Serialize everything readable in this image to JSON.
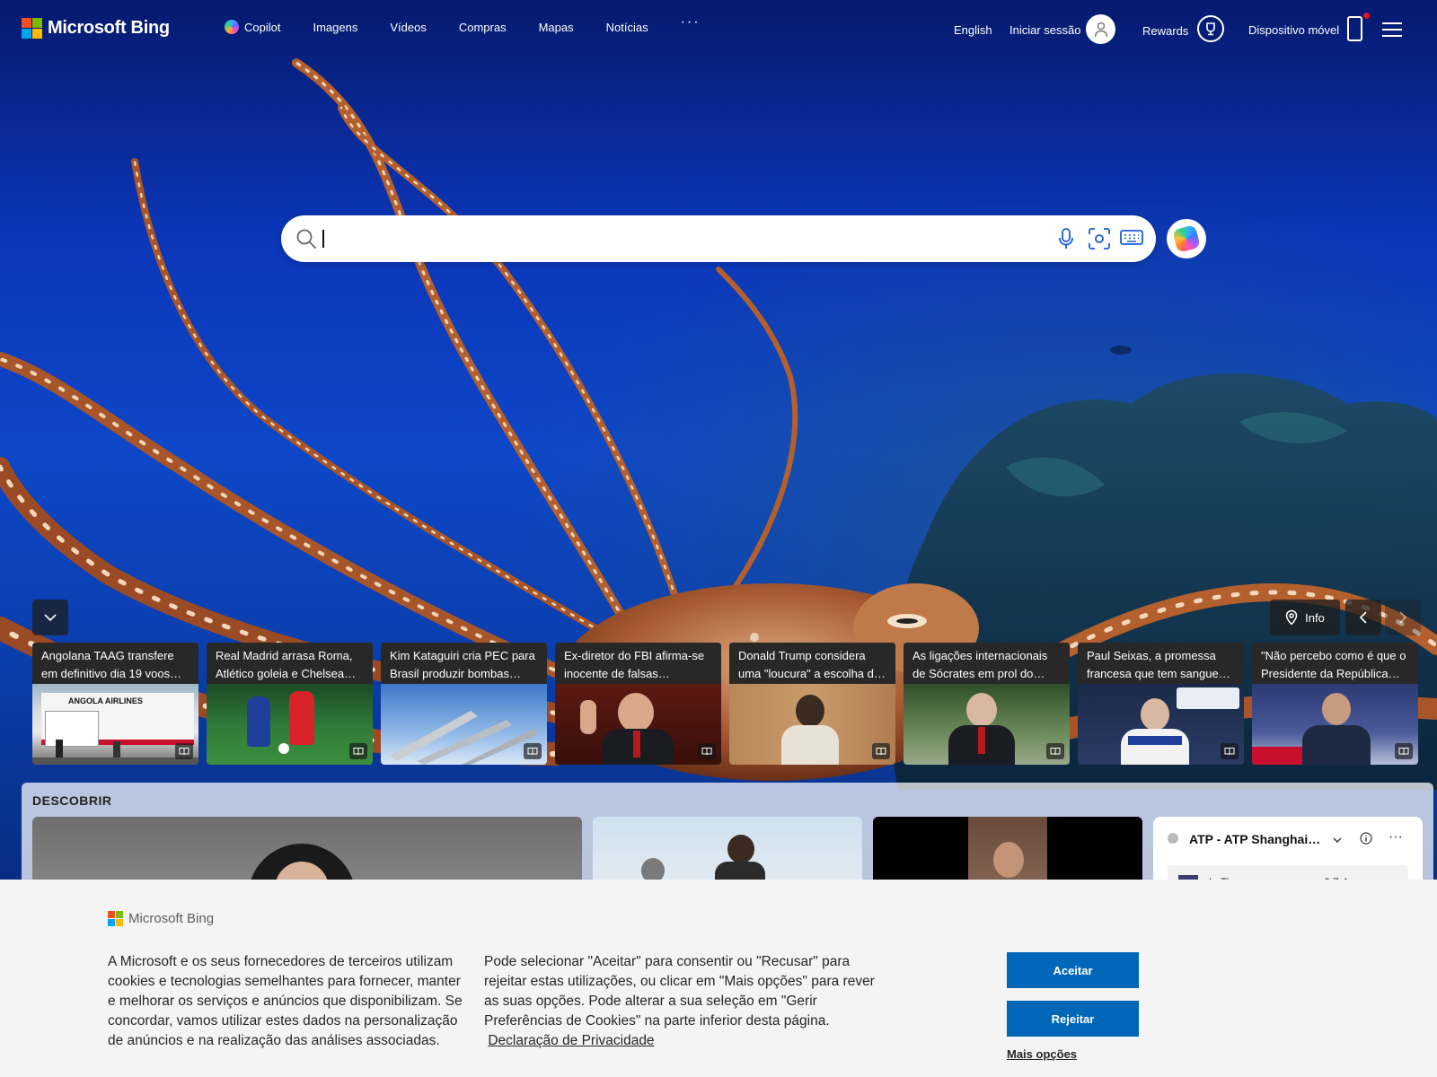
{
  "brand": {
    "name": "Microsoft Bing",
    "colors": {
      "red": "#f25022",
      "green": "#7fba00",
      "blue": "#00a4ef",
      "yellow": "#ffb900"
    }
  },
  "nav": {
    "items": [
      {
        "label": "Copilot",
        "icon": "copilot-icon"
      },
      {
        "label": "Imagens"
      },
      {
        "label": "Vídeos"
      },
      {
        "label": "Compras"
      },
      {
        "label": "Mapas"
      },
      {
        "label": "Notícias"
      }
    ],
    "more_label": "···"
  },
  "header": {
    "language": "English",
    "sign_in": "Iniciar sessão",
    "rewards": "Rewards",
    "mobile": "Dispositivo móvel"
  },
  "search": {
    "value": "",
    "icons": [
      "mic-icon",
      "visual-search-icon",
      "keyboard-icon"
    ]
  },
  "news_controls": {
    "info_label": "Info"
  },
  "news": [
    {
      "title": "Angolana TAAG transfere em definitivo dia 19 voos…",
      "thumb_text": "ANGOLA AIRLINES"
    },
    {
      "title": "Real Madrid arrasa Roma, Atlético goleia e Chelsea…"
    },
    {
      "title": "Kim Kataguiri cria PEC para Brasil produzir bombas…"
    },
    {
      "title": "Ex-diretor do FBI afirma-se inocente de falsas…"
    },
    {
      "title": "Donald Trump considera uma \"loucura\" a escolha d…"
    },
    {
      "title": "As ligações internacionais de Sócrates em prol do…"
    },
    {
      "title": "Paul Seixas, a promessa francesa que tem sangue…"
    },
    {
      "title": "\"Não percebo como é que o Presidente da República e…"
    }
  ],
  "discover": {
    "title": "DESCOBRIR",
    "widget": {
      "title": "ATP - ATP Shanghai…",
      "row_name": "L. Tien",
      "row_score": "6 7 4"
    }
  },
  "cookie": {
    "logo_text": "Microsoft Bing",
    "text_left": "A Microsoft e os seus fornecedores de terceiros utilizam cookies e tecnologias semelhantes para fornecer, manter e melhorar os serviços e anúncios que disponibilizam. Se concordar, vamos utilizar estes dados na personalização de anúncios e na realização das análises associadas.",
    "text_right": "Pode selecionar \"Aceitar\" para consentir ou \"Recusar\" para rejeitar estas utilizações, ou clicar em \"Mais opções\" para rever as suas opções. Pode alterar a sua seleção em \"Gerir Preferências de Cookies\" na parte inferior desta página.",
    "privacy_link": "Declaração de Privacidade",
    "accept": "Aceitar",
    "reject": "Rejeitar",
    "more_options": "Mais opções"
  }
}
